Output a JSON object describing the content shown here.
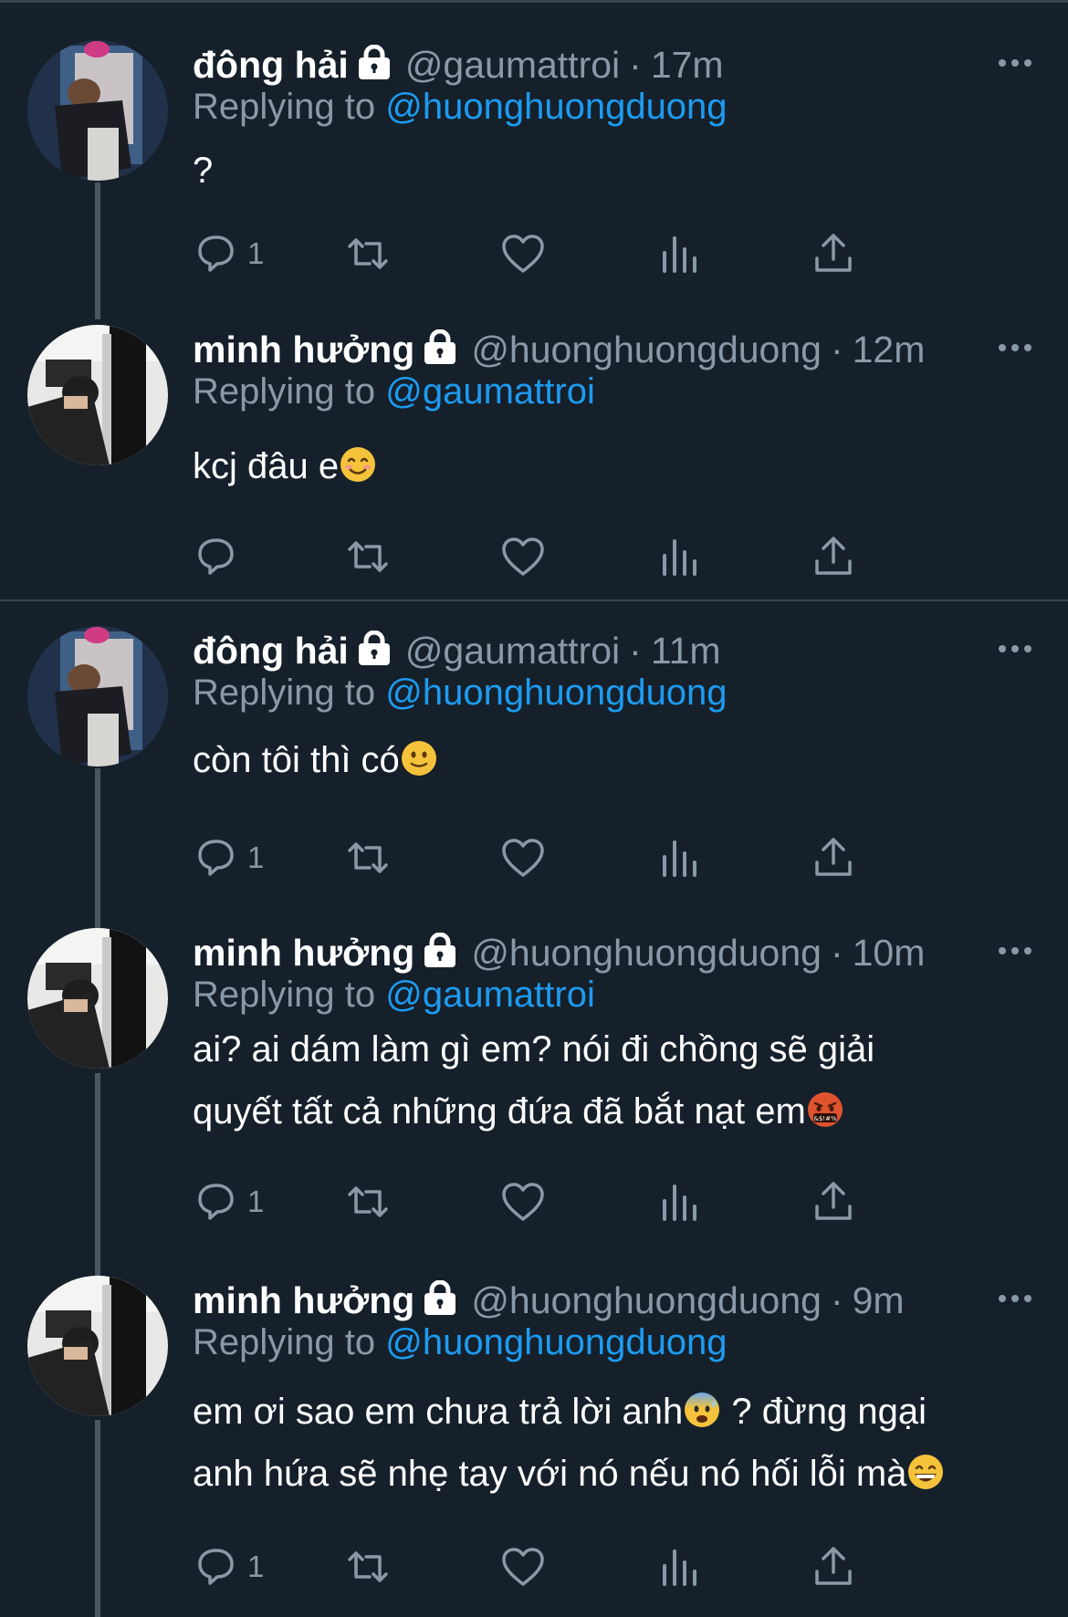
{
  "colors": {
    "background": "#15202b",
    "text_primary": "#ffffff",
    "text_secondary": "#8b98a5",
    "link": "#1d9bf0",
    "divider": "#38444d"
  },
  "tweets": [
    {
      "name": "đông hải",
      "handle": "@gaumattroi",
      "time": "17m",
      "replying_label": "Replying to",
      "replying_to": "@huonghuongduong",
      "lines": [
        "?"
      ],
      "reply_count": "1",
      "avatar": "photo-avatar-donghai"
    },
    {
      "name": "minh hưởng",
      "handle": "@huonghuongduong",
      "time": "12m",
      "replying_label": "Replying to",
      "replying_to": "@gaumattroi",
      "lines": [
        "kcj đâu e"
      ],
      "emoji": "smiling-face-emoji",
      "reply_count": "",
      "avatar": "photo-avatar-minhhuong"
    },
    {
      "name": "đông hải",
      "handle": "@gaumattroi",
      "time": "11m",
      "replying_label": "Replying to",
      "replying_to": "@huonghuongduong",
      "lines": [
        "còn tôi thì có"
      ],
      "emoji": "slightly-smiling-face-emoji",
      "reply_count": "1",
      "avatar": "photo-avatar-donghai"
    },
    {
      "name": "minh hưởng",
      "handle": "@huonghuongduong",
      "time": "10m",
      "replying_label": "Replying to",
      "replying_to": "@gaumattroi",
      "lines": [
        "ai? ai dám làm gì em? nói đi chồng sẽ giải",
        "quyết tất cả những đứa đã bắt nạt em"
      ],
      "emoji": "face-with-symbols-emoji",
      "reply_count": "1",
      "avatar": "photo-avatar-minhhuong"
    },
    {
      "name": "minh hưởng",
      "handle": "@huonghuongduong",
      "time": "9m",
      "replying_label": "Replying to",
      "replying_to": "@huonghuongduong",
      "lines": [
        "em ơi sao em chưa trả lời anh",
        " ? đừng ngại",
        "anh hứa sẽ nhẹ tay với nó nếu nó hối lỗi mà"
      ],
      "emoji": "anxious-face-emoji",
      "emoji2": "grinning-face-emoji",
      "reply_count": "1",
      "avatar": "photo-avatar-minhhuong"
    }
  ]
}
